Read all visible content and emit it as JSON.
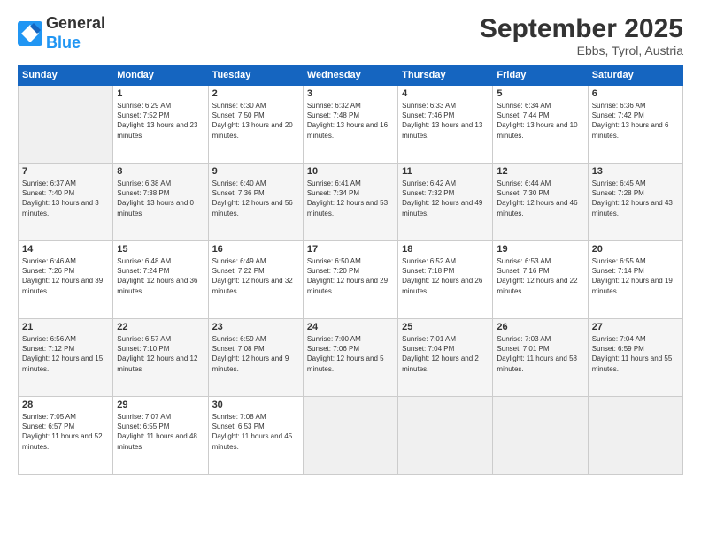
{
  "logo": {
    "text_general": "General",
    "text_blue": "Blue"
  },
  "header": {
    "month_year": "September 2025",
    "location": "Ebbs, Tyrol, Austria"
  },
  "weekdays": [
    "Sunday",
    "Monday",
    "Tuesday",
    "Wednesday",
    "Thursday",
    "Friday",
    "Saturday"
  ],
  "weeks": [
    [
      {
        "day": "",
        "empty": true
      },
      {
        "day": "1",
        "sunrise": "Sunrise: 6:29 AM",
        "sunset": "Sunset: 7:52 PM",
        "daylight": "Daylight: 13 hours and 23 minutes."
      },
      {
        "day": "2",
        "sunrise": "Sunrise: 6:30 AM",
        "sunset": "Sunset: 7:50 PM",
        "daylight": "Daylight: 13 hours and 20 minutes."
      },
      {
        "day": "3",
        "sunrise": "Sunrise: 6:32 AM",
        "sunset": "Sunset: 7:48 PM",
        "daylight": "Daylight: 13 hours and 16 minutes."
      },
      {
        "day": "4",
        "sunrise": "Sunrise: 6:33 AM",
        "sunset": "Sunset: 7:46 PM",
        "daylight": "Daylight: 13 hours and 13 minutes."
      },
      {
        "day": "5",
        "sunrise": "Sunrise: 6:34 AM",
        "sunset": "Sunset: 7:44 PM",
        "daylight": "Daylight: 13 hours and 10 minutes."
      },
      {
        "day": "6",
        "sunrise": "Sunrise: 6:36 AM",
        "sunset": "Sunset: 7:42 PM",
        "daylight": "Daylight: 13 hours and 6 minutes."
      }
    ],
    [
      {
        "day": "7",
        "sunrise": "Sunrise: 6:37 AM",
        "sunset": "Sunset: 7:40 PM",
        "daylight": "Daylight: 13 hours and 3 minutes."
      },
      {
        "day": "8",
        "sunrise": "Sunrise: 6:38 AM",
        "sunset": "Sunset: 7:38 PM",
        "daylight": "Daylight: 13 hours and 0 minutes."
      },
      {
        "day": "9",
        "sunrise": "Sunrise: 6:40 AM",
        "sunset": "Sunset: 7:36 PM",
        "daylight": "Daylight: 12 hours and 56 minutes."
      },
      {
        "day": "10",
        "sunrise": "Sunrise: 6:41 AM",
        "sunset": "Sunset: 7:34 PM",
        "daylight": "Daylight: 12 hours and 53 minutes."
      },
      {
        "day": "11",
        "sunrise": "Sunrise: 6:42 AM",
        "sunset": "Sunset: 7:32 PM",
        "daylight": "Daylight: 12 hours and 49 minutes."
      },
      {
        "day": "12",
        "sunrise": "Sunrise: 6:44 AM",
        "sunset": "Sunset: 7:30 PM",
        "daylight": "Daylight: 12 hours and 46 minutes."
      },
      {
        "day": "13",
        "sunrise": "Sunrise: 6:45 AM",
        "sunset": "Sunset: 7:28 PM",
        "daylight": "Daylight: 12 hours and 43 minutes."
      }
    ],
    [
      {
        "day": "14",
        "sunrise": "Sunrise: 6:46 AM",
        "sunset": "Sunset: 7:26 PM",
        "daylight": "Daylight: 12 hours and 39 minutes."
      },
      {
        "day": "15",
        "sunrise": "Sunrise: 6:48 AM",
        "sunset": "Sunset: 7:24 PM",
        "daylight": "Daylight: 12 hours and 36 minutes."
      },
      {
        "day": "16",
        "sunrise": "Sunrise: 6:49 AM",
        "sunset": "Sunset: 7:22 PM",
        "daylight": "Daylight: 12 hours and 32 minutes."
      },
      {
        "day": "17",
        "sunrise": "Sunrise: 6:50 AM",
        "sunset": "Sunset: 7:20 PM",
        "daylight": "Daylight: 12 hours and 29 minutes."
      },
      {
        "day": "18",
        "sunrise": "Sunrise: 6:52 AM",
        "sunset": "Sunset: 7:18 PM",
        "daylight": "Daylight: 12 hours and 26 minutes."
      },
      {
        "day": "19",
        "sunrise": "Sunrise: 6:53 AM",
        "sunset": "Sunset: 7:16 PM",
        "daylight": "Daylight: 12 hours and 22 minutes."
      },
      {
        "day": "20",
        "sunrise": "Sunrise: 6:55 AM",
        "sunset": "Sunset: 7:14 PM",
        "daylight": "Daylight: 12 hours and 19 minutes."
      }
    ],
    [
      {
        "day": "21",
        "sunrise": "Sunrise: 6:56 AM",
        "sunset": "Sunset: 7:12 PM",
        "daylight": "Daylight: 12 hours and 15 minutes."
      },
      {
        "day": "22",
        "sunrise": "Sunrise: 6:57 AM",
        "sunset": "Sunset: 7:10 PM",
        "daylight": "Daylight: 12 hours and 12 minutes."
      },
      {
        "day": "23",
        "sunrise": "Sunrise: 6:59 AM",
        "sunset": "Sunset: 7:08 PM",
        "daylight": "Daylight: 12 hours and 9 minutes."
      },
      {
        "day": "24",
        "sunrise": "Sunrise: 7:00 AM",
        "sunset": "Sunset: 7:06 PM",
        "daylight": "Daylight: 12 hours and 5 minutes."
      },
      {
        "day": "25",
        "sunrise": "Sunrise: 7:01 AM",
        "sunset": "Sunset: 7:04 PM",
        "daylight": "Daylight: 12 hours and 2 minutes."
      },
      {
        "day": "26",
        "sunrise": "Sunrise: 7:03 AM",
        "sunset": "Sunset: 7:01 PM",
        "daylight": "Daylight: 11 hours and 58 minutes."
      },
      {
        "day": "27",
        "sunrise": "Sunrise: 7:04 AM",
        "sunset": "Sunset: 6:59 PM",
        "daylight": "Daylight: 11 hours and 55 minutes."
      }
    ],
    [
      {
        "day": "28",
        "sunrise": "Sunrise: 7:05 AM",
        "sunset": "Sunset: 6:57 PM",
        "daylight": "Daylight: 11 hours and 52 minutes."
      },
      {
        "day": "29",
        "sunrise": "Sunrise: 7:07 AM",
        "sunset": "Sunset: 6:55 PM",
        "daylight": "Daylight: 11 hours and 48 minutes."
      },
      {
        "day": "30",
        "sunrise": "Sunrise: 7:08 AM",
        "sunset": "Sunset: 6:53 PM",
        "daylight": "Daylight: 11 hours and 45 minutes."
      },
      {
        "day": "",
        "empty": true
      },
      {
        "day": "",
        "empty": true
      },
      {
        "day": "",
        "empty": true
      },
      {
        "day": "",
        "empty": true
      }
    ]
  ]
}
